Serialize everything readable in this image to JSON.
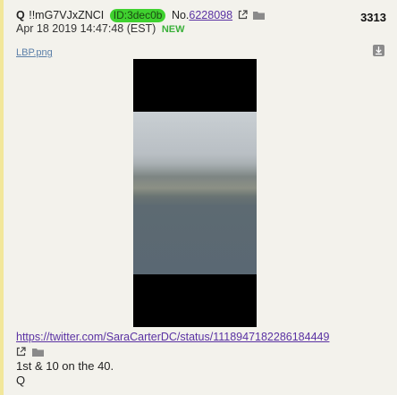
{
  "post": {
    "name": "Q",
    "tripcode": "!!mG7VJxZNCI",
    "id_label": "ID:3dec0b",
    "no_prefix": "No.",
    "post_number": "6228098",
    "reply_count": "3313",
    "timestamp": "Apr 18 2019 14:47:48 (EST)",
    "new_badge": "NEW",
    "file_name": "LBP.png",
    "link": "https://twitter.com/SaraCarterDC/status/1118947182286184449",
    "body_lines": [
      "1st & 10 on the 40.",
      "Q"
    ]
  },
  "icons": {
    "external": "external-link-icon",
    "folder": "folder-icon",
    "download": "download-icon"
  },
  "colors": {
    "id_badge": "#3fd12f",
    "link": "#5a32a3",
    "new": "#3ab03a",
    "post_border": "#f2e79a"
  }
}
